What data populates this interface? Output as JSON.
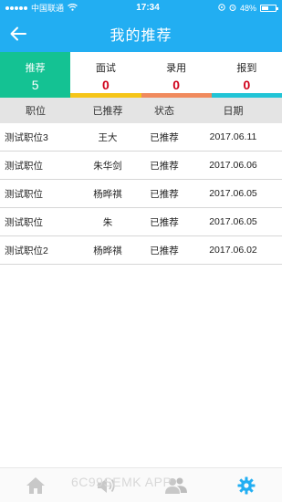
{
  "status_bar": {
    "carrier": "中国联通",
    "time": "17:34",
    "battery": "48%"
  },
  "header": {
    "title": "我的推荐"
  },
  "tabs": [
    {
      "label": "推荐",
      "count": "5",
      "color": "#14c293"
    },
    {
      "label": "面试",
      "count": "0",
      "color": "#f5c518"
    },
    {
      "label": "录用",
      "count": "0",
      "color": "#f08a5d"
    },
    {
      "label": "报到",
      "count": "0",
      "color": "#21c4d6"
    }
  ],
  "table": {
    "headers": [
      "职位",
      "已推荐",
      "状态",
      "日期"
    ],
    "rows": [
      [
        "测试职位3",
        "王大",
        "已推荐",
        "2017.06.11"
      ],
      [
        "测试职位",
        "朱华剑",
        "已推荐",
        "2017.06.06"
      ],
      [
        "测试职位",
        "杨晔祺",
        "已推荐",
        "2017.06.05"
      ],
      [
        "测试职位",
        "朱",
        "已推荐",
        "2017.06.05"
      ],
      [
        "测试职位2",
        "杨晔祺",
        "已推荐",
        "2017.06.02"
      ]
    ]
  },
  "bottom_nav": {
    "items": [
      "home-icon",
      "speaker-icon",
      "users-icon",
      "gear-icon"
    ],
    "active_color": "#22aef2"
  },
  "watermark": "6C99SEMK APP"
}
